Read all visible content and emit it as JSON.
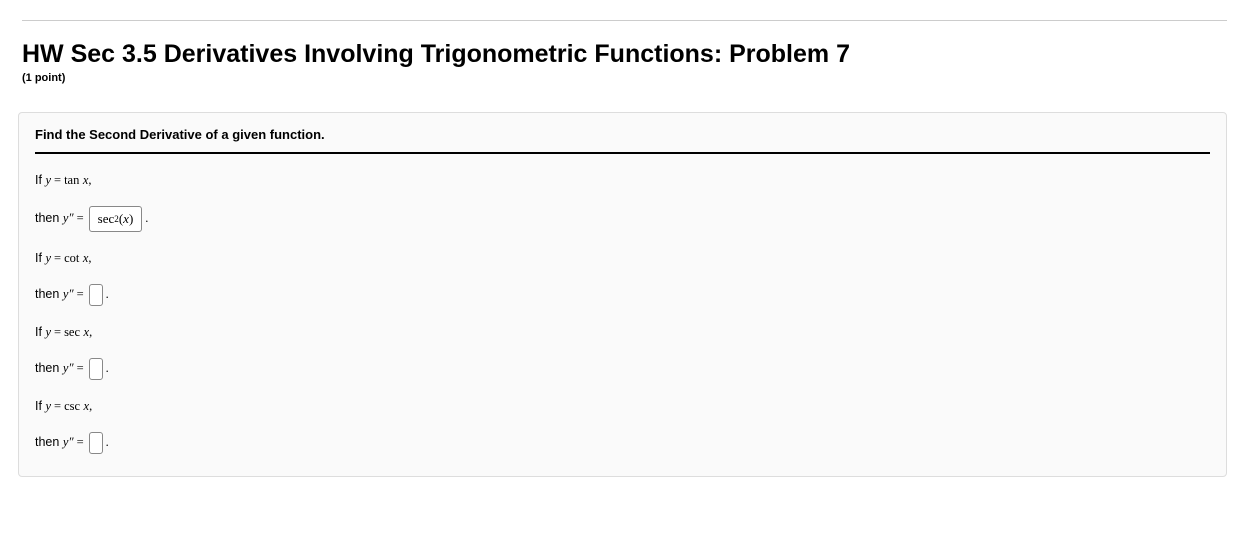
{
  "header": {
    "title": "HW Sec 3.5 Derivatives Involving Trigonometric Functions: Problem 7",
    "points": "(1 point)"
  },
  "problem": {
    "instruction": "Find the Second Derivative of a given function.",
    "parts": [
      {
        "func": "tan",
        "answer": "sec²(x)"
      },
      {
        "func": "cot",
        "answer": ""
      },
      {
        "func": "sec",
        "answer": ""
      },
      {
        "func": "csc",
        "answer": ""
      }
    ],
    "labels": {
      "if": "If",
      "then": "then",
      "y": "y",
      "x": "x",
      "equals": "=",
      "comma": ",",
      "yprimeprime": "y″",
      "dot": "."
    }
  }
}
